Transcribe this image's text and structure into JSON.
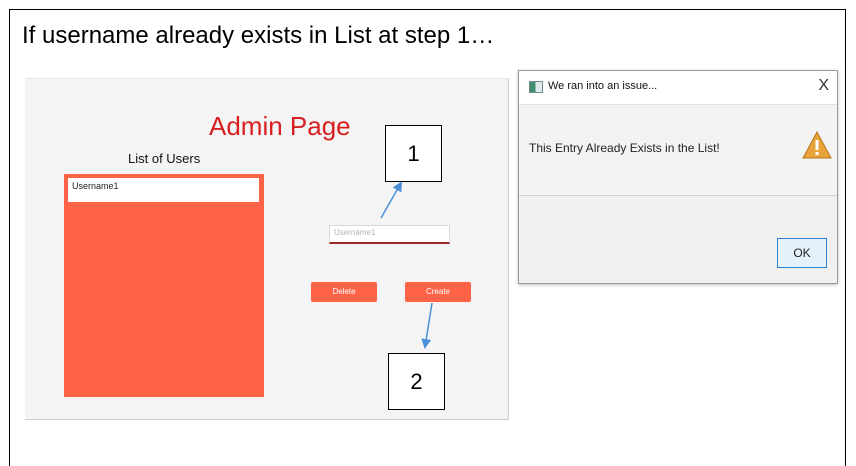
{
  "heading": "If username already exists in List at step 1…",
  "admin": {
    "title": "Admin Page",
    "list_title": "List of Users",
    "users": [
      "Username1"
    ],
    "input_placeholder": "Username1",
    "delete_label": "Delete",
    "create_label": "Create"
  },
  "callouts": {
    "step1": "1",
    "step2": "2"
  },
  "dialog": {
    "title": "We ran into an issue...",
    "close": "X",
    "message": "This Entry Already Exists in the List!",
    "ok_label": "OK",
    "icon": "warning-icon"
  },
  "colors": {
    "accent": "#ff6347",
    "title_red": "#d71f1f",
    "dialog_bg": "#f0f0f0",
    "ok_border": "#2c83d1",
    "arrow": "#4a90d9"
  }
}
